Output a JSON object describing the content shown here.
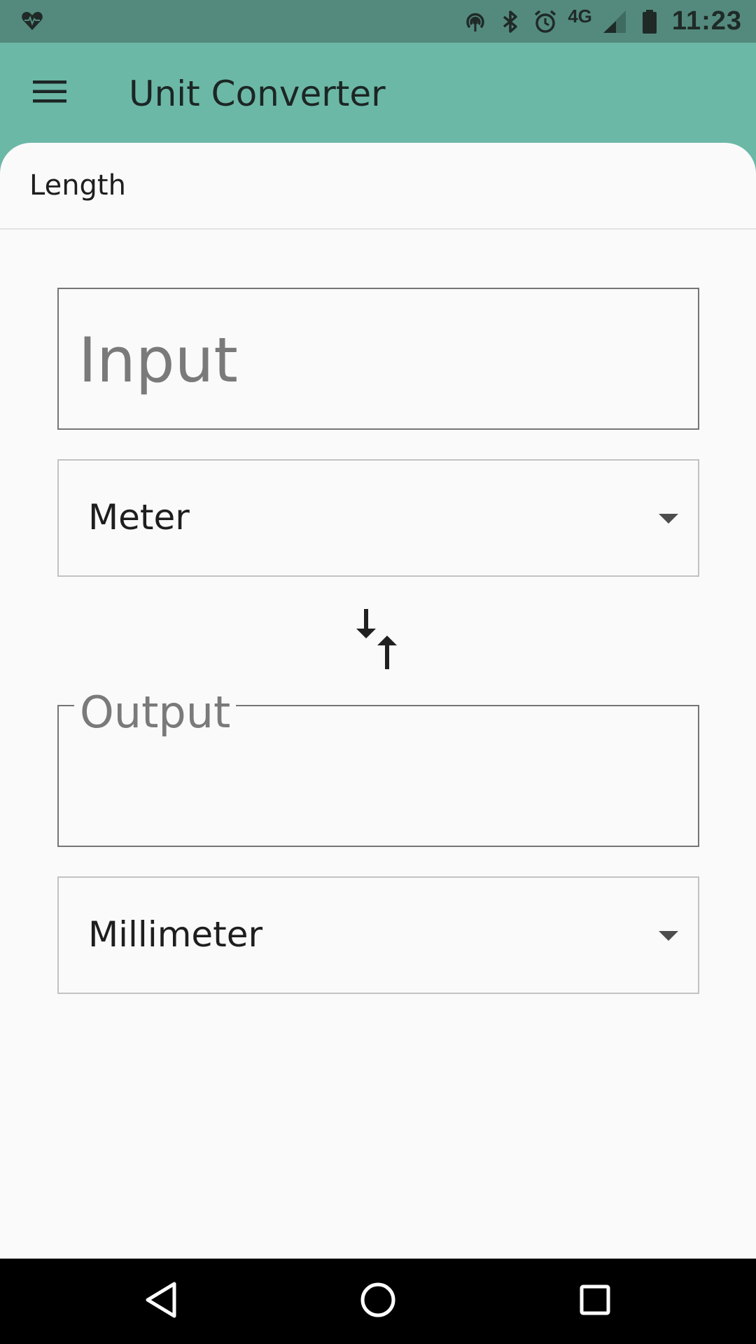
{
  "status_bar": {
    "left_icon": "health-heart-icon",
    "icons": [
      "hotspot-icon",
      "bluetooth-icon",
      "alarm-icon"
    ],
    "network": "4G",
    "signal_icon": "signal-icon",
    "battery_icon": "battery-icon",
    "time": "11:23"
  },
  "app_bar": {
    "menu_icon": "hamburger-menu-icon",
    "title": "Unit Converter"
  },
  "category": {
    "label": "Length"
  },
  "converter": {
    "input_placeholder": "Input",
    "input_value": "",
    "from_unit": "Meter",
    "swap_icon": "swap-vertical-icon",
    "output_label": "Output",
    "output_value": "",
    "to_unit": "Millimeter"
  },
  "nav_bar": {
    "back_icon": "back-triangle-icon",
    "home_icon": "home-circle-icon",
    "recent_icon": "recent-square-icon"
  },
  "colors": {
    "status_bar": "#548a7d",
    "app_bar": "#6cb8a7",
    "surface": "#fafafa",
    "nav_bar": "#000000"
  }
}
